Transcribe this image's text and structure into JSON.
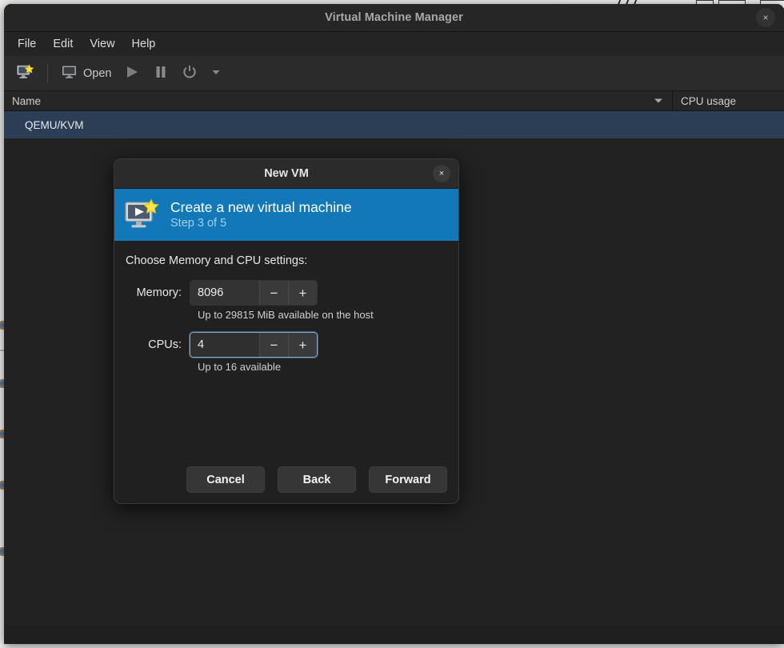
{
  "window": {
    "title": "Virtual Machine Manager",
    "close_label": "×",
    "close_icon": "close-icon"
  },
  "menubar": {
    "items": [
      {
        "label": "File"
      },
      {
        "label": "Edit"
      },
      {
        "label": "View"
      },
      {
        "label": "Help"
      }
    ]
  },
  "toolbar": {
    "new_vm_icon": "new-vm-icon",
    "open_icon": "monitor-icon",
    "open_label": "Open",
    "run_icon": "play-icon",
    "pause_icon": "pause-icon",
    "shutdown_icon": "power-icon",
    "dropdown_icon": "chevron-down-icon"
  },
  "list": {
    "columns": [
      {
        "label": "Name",
        "sort_icon": "sort-descending-arrow"
      },
      {
        "label": "CPU usage"
      }
    ],
    "rows": [
      {
        "name": "QEMU/KVM",
        "cpu_usage": ""
      }
    ]
  },
  "dialog": {
    "title": "New VM",
    "close_label": "×",
    "close_icon": "close-icon",
    "banner": {
      "icon": "create-vm-icon",
      "heading": "Create a new virtual machine",
      "step": "Step 3 of 5"
    },
    "prompt": "Choose Memory and CPU settings:",
    "fields": [
      {
        "label": "Memory:",
        "value": "8096",
        "placeholder": "",
        "minus_label": "−",
        "plus_label": "+",
        "hint": "Up to 29815 MiB available on the host",
        "focused": false
      },
      {
        "label": "CPUs:",
        "value": "4",
        "placeholder": "",
        "minus_label": "−",
        "plus_label": "+",
        "hint": "Up to 16 available",
        "focused": true
      }
    ],
    "buttons": [
      {
        "label": "Cancel"
      },
      {
        "label": "Back"
      },
      {
        "label": "Forward"
      }
    ]
  },
  "colors": {
    "accent_blue": "#1278b8",
    "selection_blue": "#2c3e55",
    "focus_ring": "#7ba7cc",
    "window_bg": "#1f1f1f",
    "titlebar_bg": "#262626",
    "desktop_bg": "#eeeeed",
    "star_yellow": "#f5d53a"
  }
}
